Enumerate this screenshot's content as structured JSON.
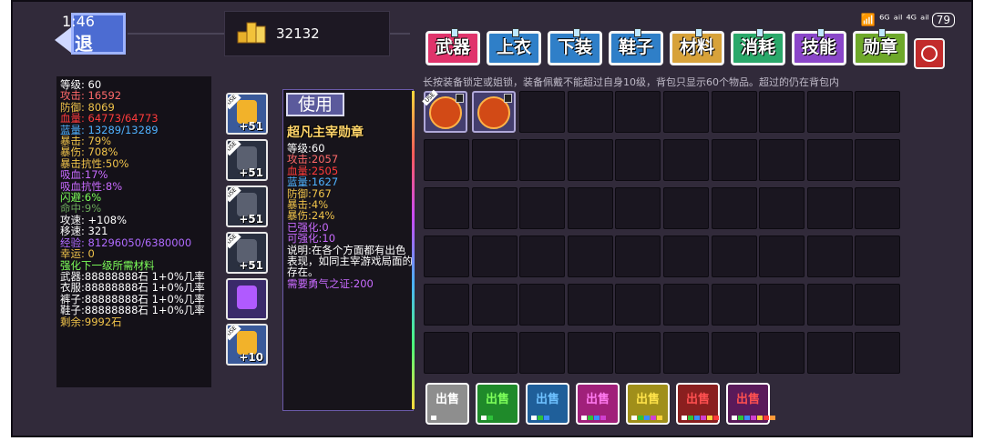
{
  "status": {
    "clock": "1:46",
    "network": "⁶ᴳ ᵃⁱˡ ⁴ᴳ ᵃⁱˡ",
    "battery": "79"
  },
  "back": {
    "label": "退"
  },
  "currency": {
    "gold": "32132",
    "icon": "gold-coins-icon"
  },
  "tabs": [
    {
      "label": "武器",
      "color": "#e0336b"
    },
    {
      "label": "上衣",
      "color": "#2f7fc8"
    },
    {
      "label": "下装",
      "color": "#2f7fc8"
    },
    {
      "label": "鞋子",
      "color": "#2f7fc8"
    },
    {
      "label": "材料",
      "color": "#d7a23a"
    },
    {
      "label": "消耗",
      "color": "#2aa86a"
    },
    {
      "label": "技能",
      "color": "#8a46c9"
    },
    {
      "label": "勋章",
      "color": "#6ea82a"
    }
  ],
  "hint": "长按装备锁定或姐锁，装备佩戴不能超过自身10级，背包只显示60个物品。超过的仍在背包内",
  "stats": [
    {
      "text": "等级: 60",
      "color": "#ffffff"
    },
    {
      "text": "攻击: 16592",
      "color": "#ff6a6a"
    },
    {
      "text": "防御: 8069",
      "color": "#f0c34a"
    },
    {
      "text": "血量: 64773/64773",
      "color": "#ff3b3b"
    },
    {
      "text": "蓝量: 13289/13289",
      "color": "#4fb2ff"
    },
    {
      "text": "暴击: 79%",
      "color": "#f0c34a"
    },
    {
      "text": "暴伤: 708%",
      "color": "#f0c34a"
    },
    {
      "text": "暴击抗性:50%",
      "color": "#f0c34a"
    },
    {
      "text": "吸血:17%",
      "color": "#c96bff"
    },
    {
      "text": "吸血抗性:8%",
      "color": "#c96bff"
    },
    {
      "text": "闪避:6%",
      "color": "#7dff5a"
    },
    {
      "text": "命中:9%",
      "color": "#6aa85a"
    },
    {
      "text": "攻速: +108%",
      "color": "#ffffff"
    },
    {
      "text": "移速: 321",
      "color": "#ffffff"
    },
    {
      "text": "经验: 81296050/6380000",
      "color": "#b06bff"
    },
    {
      "text": "幸运: 0",
      "color": "#f0c34a"
    },
    {
      "text": "强化下一级所需材料",
      "color": "#7dff5a"
    },
    {
      "text": "武器:88888888石 1+0%几率",
      "color": "#ffffff"
    },
    {
      "text": "衣服:88888888石 1+0%几率",
      "color": "#ffffff"
    },
    {
      "text": "裤子:88888888石 1+0%几率",
      "color": "#ffffff"
    },
    {
      "text": "鞋子:88888888石 1+0%几率",
      "color": "#ffffff"
    },
    {
      "text": "剩余:9992石",
      "color": "#f0c34a"
    }
  ],
  "equipment": [
    {
      "icon": "gold-sword-icon",
      "level": "+51",
      "tag": "USE"
    },
    {
      "icon": "dark-armor-icon",
      "level": "+51",
      "tag": "USE"
    },
    {
      "icon": "dark-pants-icon",
      "level": "+51",
      "tag": "USE"
    },
    {
      "icon": "dark-boots-icon",
      "level": "+51",
      "tag": "USE"
    },
    {
      "icon": "purple-skill-icon",
      "level": "",
      "tag": ""
    },
    {
      "icon": "medal-coin-icon",
      "level": "+10",
      "tag": "USE"
    }
  ],
  "detail": {
    "use_label": "使用",
    "name": "超凡主宰勋章",
    "lines": [
      {
        "text": "等级:60",
        "color": "#ffffff"
      },
      {
        "text": "攻击:2057",
        "color": "#ff6a6a"
      },
      {
        "text": "血量:2505",
        "color": "#ff3b3b"
      },
      {
        "text": "蓝量:1627",
        "color": "#4fb2ff"
      },
      {
        "text": "防御:767",
        "color": "#f0c34a"
      },
      {
        "text": "暴击:4%",
        "color": "#f0c34a"
      },
      {
        "text": "暴伤:24%",
        "color": "#f0c34a"
      },
      {
        "text": "已强化:0",
        "color": "#c96bff"
      },
      {
        "text": "可强化:10",
        "color": "#c96bff"
      },
      {
        "text": "说明:在各个方面都有出色表现，如同主宰游戏局面的存在。",
        "color": "#ffffff"
      },
      {
        "text": "需要勇气之证:200",
        "color": "#c96bff"
      }
    ]
  },
  "inventory": [
    {
      "icon": "gold-sword-coin-icon",
      "tag": "USE",
      "locked": true
    },
    {
      "icon": "gold-armor-coin-icon",
      "tag": "",
      "locked": true
    }
  ],
  "sell_buttons": [
    {
      "label": "出售",
      "bg": "#8e8e8e",
      "fg": "#ffffff",
      "dots": [
        "#ffffff"
      ]
    },
    {
      "label": "出售",
      "bg": "#1f8a2a",
      "fg": "#7dff5a",
      "dots": [
        "#ffffff",
        "#2ec23a"
      ]
    },
    {
      "label": "出售",
      "bg": "#1f5f9a",
      "fg": "#6ec1ff",
      "dots": [
        "#ffffff",
        "#2ec23a",
        "#3a8cff"
      ]
    },
    {
      "label": "出售",
      "bg": "#a0207a",
      "fg": "#ff7af0",
      "dots": [
        "#ffffff",
        "#2ec23a",
        "#3a8cff",
        "#d040d0"
      ]
    },
    {
      "label": "出售",
      "bg": "#a08f1a",
      "fg": "#ffe34a",
      "dots": [
        "#ffffff",
        "#2ec23a",
        "#3a8cff",
        "#d040d0",
        "#ffd23a"
      ]
    },
    {
      "label": "出售",
      "bg": "#8a1f1f",
      "fg": "#ff5050",
      "dots": [
        "#ffffff",
        "#2ec23a",
        "#3a8cff",
        "#d040d0",
        "#ffd23a",
        "#ff3a3a"
      ]
    },
    {
      "label": "出售",
      "bg": "#5a1a5a",
      "fg": "#ff5050",
      "dots": [
        "#ffffff",
        "#2ec23a",
        "#3a8cff",
        "#d040d0",
        "#ffd23a",
        "#ff3a3a",
        "#ff9a3a"
      ]
    }
  ]
}
